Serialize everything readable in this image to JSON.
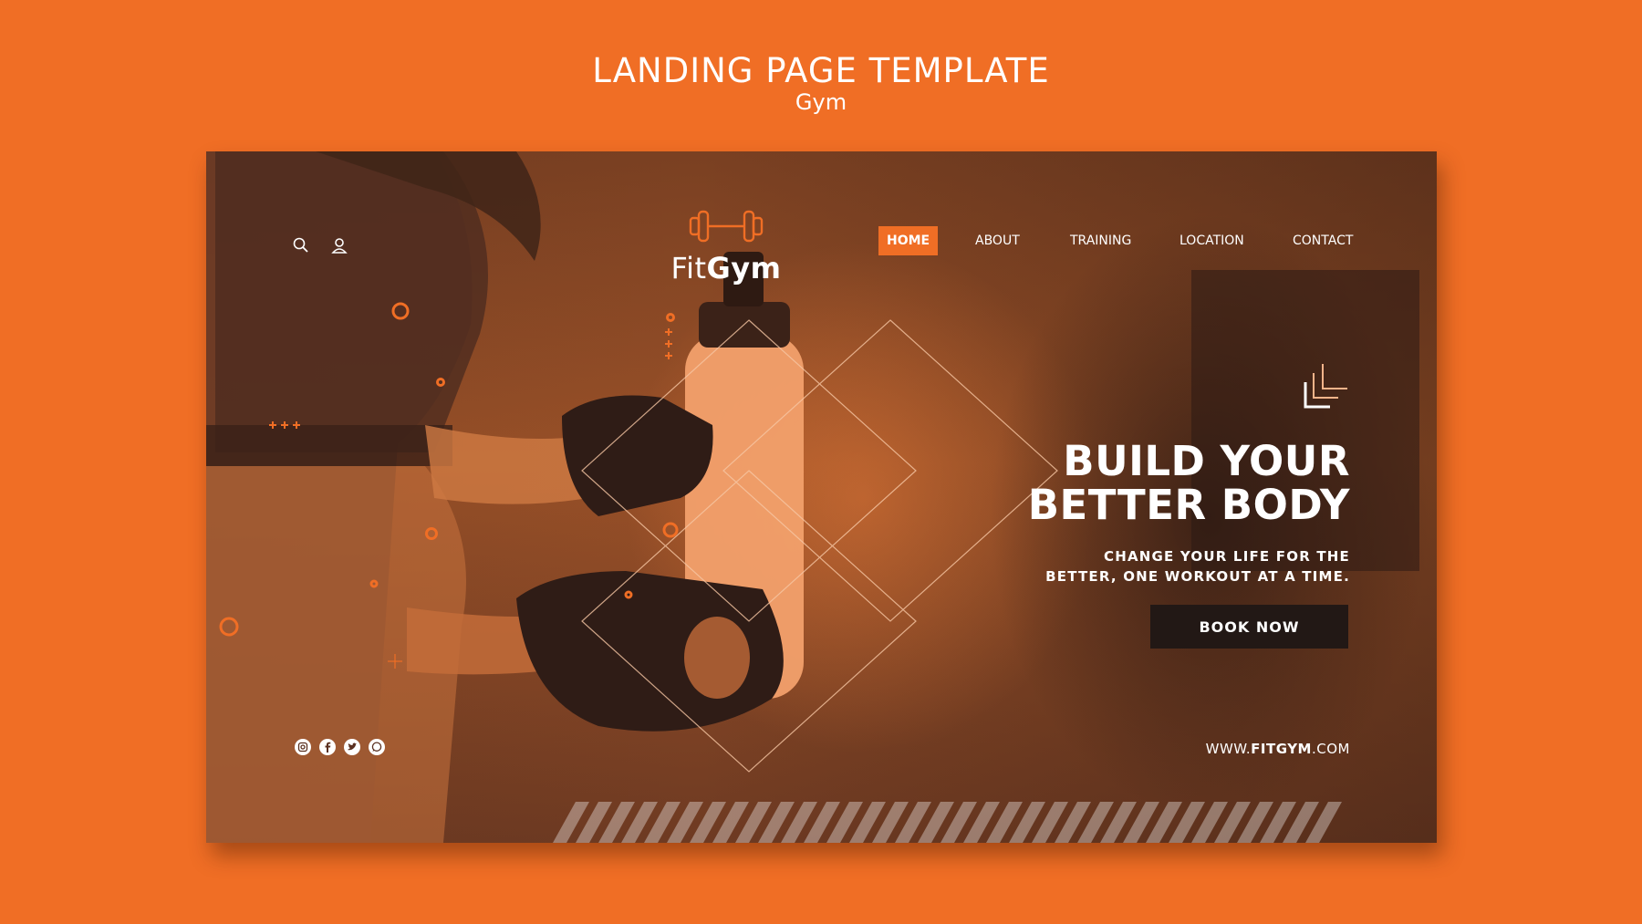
{
  "showcase": {
    "title": "LANDING PAGE TEMPLATE",
    "subtitle": "Gym"
  },
  "header": {
    "search_icon": "search-icon",
    "user_icon": "user-icon",
    "logo": {
      "icon": "dumbbell-icon",
      "text_light": "Fit",
      "text_bold": "Gym"
    }
  },
  "nav": [
    {
      "label": "HOME",
      "active": true
    },
    {
      "label": "ABOUT",
      "active": false
    },
    {
      "label": "TRAINING",
      "active": false
    },
    {
      "label": "LOCATION",
      "active": false
    },
    {
      "label": "CONTACT",
      "active": false
    }
  ],
  "hero": {
    "title_line1": "BUILD YOUR",
    "title_line2": "BETTER BODY",
    "subtitle_line1": "CHANGE YOUR LIFE FOR THE",
    "subtitle_line2": "BETTER, ONE WORKOUT AT A TIME.",
    "cta_label": "BOOK NOW"
  },
  "footer": {
    "website_prefix": "WWW.",
    "website_bold": "FITGYM",
    "website_suffix": ".COM",
    "social_icons": [
      "instagram-icon",
      "facebook-icon",
      "twitter-icon",
      "whatsapp-icon"
    ]
  },
  "colors": {
    "brand_orange": "#f06e25",
    "button_dark": "#221815",
    "text_white": "#ffffff"
  }
}
